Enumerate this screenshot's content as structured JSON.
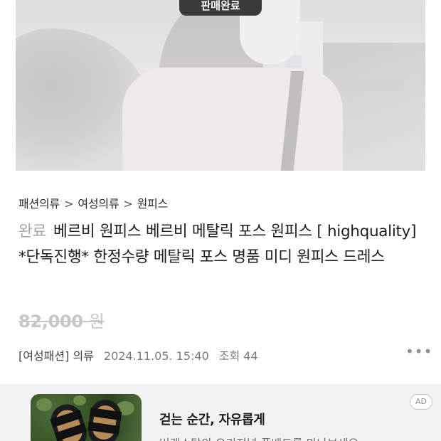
{
  "photo": {
    "status_badge": "판매완료"
  },
  "breadcrumb": [
    "패션의류",
    "여성의류",
    "원피스"
  ],
  "product": {
    "status": "완료",
    "title": "베르비 원피스 베르비 메탈릭 포스 원피스 [ highquality] *단독진행* 한정수량 메탈릭 포스 명품 미디 원피스 드레스",
    "price": "82,000",
    "price_unit": "원"
  },
  "meta": {
    "category": "[여성패션] 의류",
    "date": "2024.11.05. 15:40",
    "views": "조회 44",
    "more_icon": "more-horizontal-icon"
  },
  "ad": {
    "headline": "걷는 순간, 자유롭게",
    "sub": "버켄스탁의 오리지널 풋베드를 만나보세요",
    "tag": "AD"
  },
  "colors": {
    "status_gray": "#a5a5a9",
    "price_strike": "#c7c7cb",
    "ad_background": "#f2f2f4"
  }
}
